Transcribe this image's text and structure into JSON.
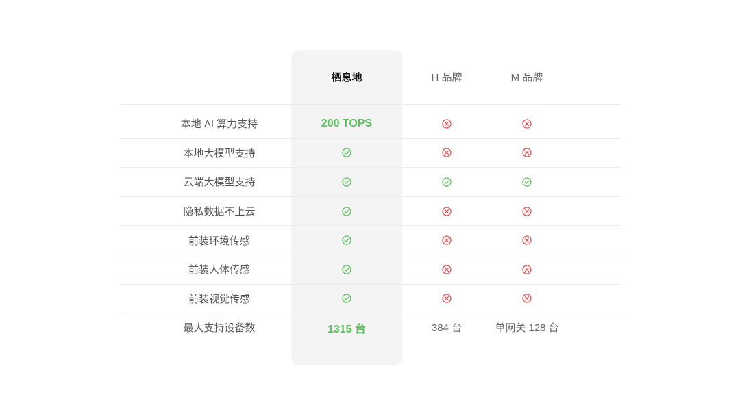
{
  "colors": {
    "check": "#5cc05c",
    "cross": "#e05555",
    "highlight": "#f4f4f4"
  },
  "header": {
    "ours": "栖息地",
    "h_brand": "H 品牌",
    "m_brand": "M 品牌"
  },
  "rows": [
    {
      "label": "本地 AI 算力支持",
      "ours": "200 TOPS",
      "h": "cross-icon",
      "m": "cross-icon"
    },
    {
      "label": "本地大模型支持",
      "ours": "check-icon",
      "h": "cross-icon",
      "m": "cross-icon"
    },
    {
      "label": "云端大模型支持",
      "ours": "check-icon",
      "h": "check-icon",
      "m": "check-icon"
    },
    {
      "label": "隐私数据不上云",
      "ours": "check-icon",
      "h": "cross-icon",
      "m": "cross-icon"
    },
    {
      "label": "前装环境传感",
      "ours": "check-icon",
      "h": "cross-icon",
      "m": "cross-icon"
    },
    {
      "label": "前装人体传感",
      "ours": "check-icon",
      "h": "cross-icon",
      "m": "cross-icon"
    },
    {
      "label": "前装视觉传感",
      "ours": "check-icon",
      "h": "cross-icon",
      "m": "cross-icon"
    },
    {
      "label": "最大支持设备数",
      "ours": "1315 台",
      "h": "384 台",
      "m": "单网关 128 台"
    }
  ]
}
